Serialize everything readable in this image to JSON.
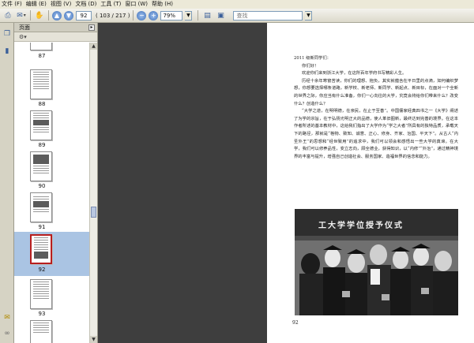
{
  "menubar": {
    "items": [
      "文件 (F)",
      "编辑 (E)",
      "视图 (V)",
      "文档 (D)",
      "工具 (T)",
      "窗口 (W)",
      "帮助 (H)"
    ]
  },
  "toolbar": {
    "page_value": "92",
    "page_count": "( 103 / 217 )",
    "zoom_value": "79%",
    "search_placeholder": "查找"
  },
  "panel": {
    "title": "页面",
    "options_icon": "options-icon",
    "thumbnails": [
      {
        "label": "87"
      },
      {
        "label": "88"
      },
      {
        "label": "89"
      },
      {
        "label": "90"
      },
      {
        "label": "91"
      },
      {
        "label": "92",
        "selected": true
      },
      {
        "label": "93"
      }
    ]
  },
  "document": {
    "greeting": "2011 级新同学们：",
    "hello": "你们好！",
    "paragraphs": [
      "欢迎你们来到浙江大学，在这所百年学府书写精彩人生。",
      "历经十余年寒窗苦读，你们的理想、抱负，其实就蕴含在平日里的点滴，如何编织梦想，你想要选择哪条道路，新学校、新老师、新同学、新起点、新目标，在面对一个全新的世界之际，你应当有什么准备，你们一心向往的大学，究竟会将给你们带来什么？改变什么？创造什么？",
      "“大学之道，在明明德，在亲民，在止于至善”。中国儒家经典四书之一《大学》阐述了为学的宗旨，在于弘扬光明正大的品德，使人革旧图新，最终达到完善的境界。在这本作者所述的基本教材中，这给我们指出了大学作为“学之大者”所具有的独特品质，承载天下的路径，那就是“格物、致知、诚意、正心、修身、齐家、治国、平天下”。从古人“内圣外王”的思想和“经世致用”的追求中，我们可以领会和感悟出一些大学的真谛。在大学，我们可以修养品性，变立志向，顾全德业，获得知识，以“内修”“外治”，通过精神境界的丰富与提升，增强自己创造社会、服务国家、造福世界的信念和能力。"
    ],
    "photo_banner": "工大学学位授予仪式",
    "page_number": "92"
  }
}
